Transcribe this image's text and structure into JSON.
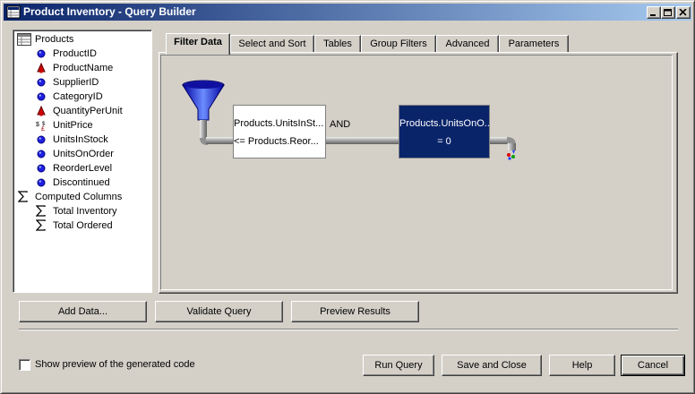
{
  "window": {
    "title": "Product Inventory - Query Builder"
  },
  "tree": {
    "root": "Products",
    "fields": [
      {
        "label": "ProductID",
        "icon": "blue-circle-icon"
      },
      {
        "label": "ProductName",
        "icon": "red-triangle-icon"
      },
      {
        "label": "SupplierID",
        "icon": "blue-circle-icon"
      },
      {
        "label": "CategoryID",
        "icon": "blue-circle-icon"
      },
      {
        "label": "QuantityPerUnit",
        "icon": "red-triangle-icon"
      },
      {
        "label": "UnitPrice",
        "icon": "currency-icon"
      },
      {
        "label": "UnitsInStock",
        "icon": "blue-circle-icon"
      },
      {
        "label": "UnitsOnOrder",
        "icon": "blue-circle-icon"
      },
      {
        "label": "ReorderLevel",
        "icon": "blue-circle-icon"
      },
      {
        "label": "Discontinued",
        "icon": "blue-circle-icon"
      }
    ],
    "computed_group": "Computed Columns",
    "computed": [
      {
        "label": "Total Inventory"
      },
      {
        "label": "Total Ordered"
      }
    ]
  },
  "tabs": [
    {
      "label": "Filter Data",
      "active": true
    },
    {
      "label": "Select and Sort"
    },
    {
      "label": "Tables"
    },
    {
      "label": "Group Filters"
    },
    {
      "label": "Advanced"
    },
    {
      "label": "Parameters"
    }
  ],
  "filter": {
    "node1_line1": "Products.UnitsInSt...",
    "node1_line2": "<= Products.Reor...",
    "operator": "AND",
    "node2_line1": "Products.UnitsOnO...",
    "node2_line2": "= 0"
  },
  "buttons": {
    "add_data": "Add Data...",
    "validate": "Validate Query",
    "preview": "Preview Results",
    "run_query": "Run Query",
    "save_close": "Save and Close",
    "help": "Help",
    "cancel": "Cancel"
  },
  "preview_checkbox_label": "Show preview of the generated code",
  "colors": {
    "title_gradient_start": "#0a246a",
    "title_gradient_end": "#a6caf0",
    "selected_node": "#0a246a",
    "face": "#d4d0c8"
  }
}
